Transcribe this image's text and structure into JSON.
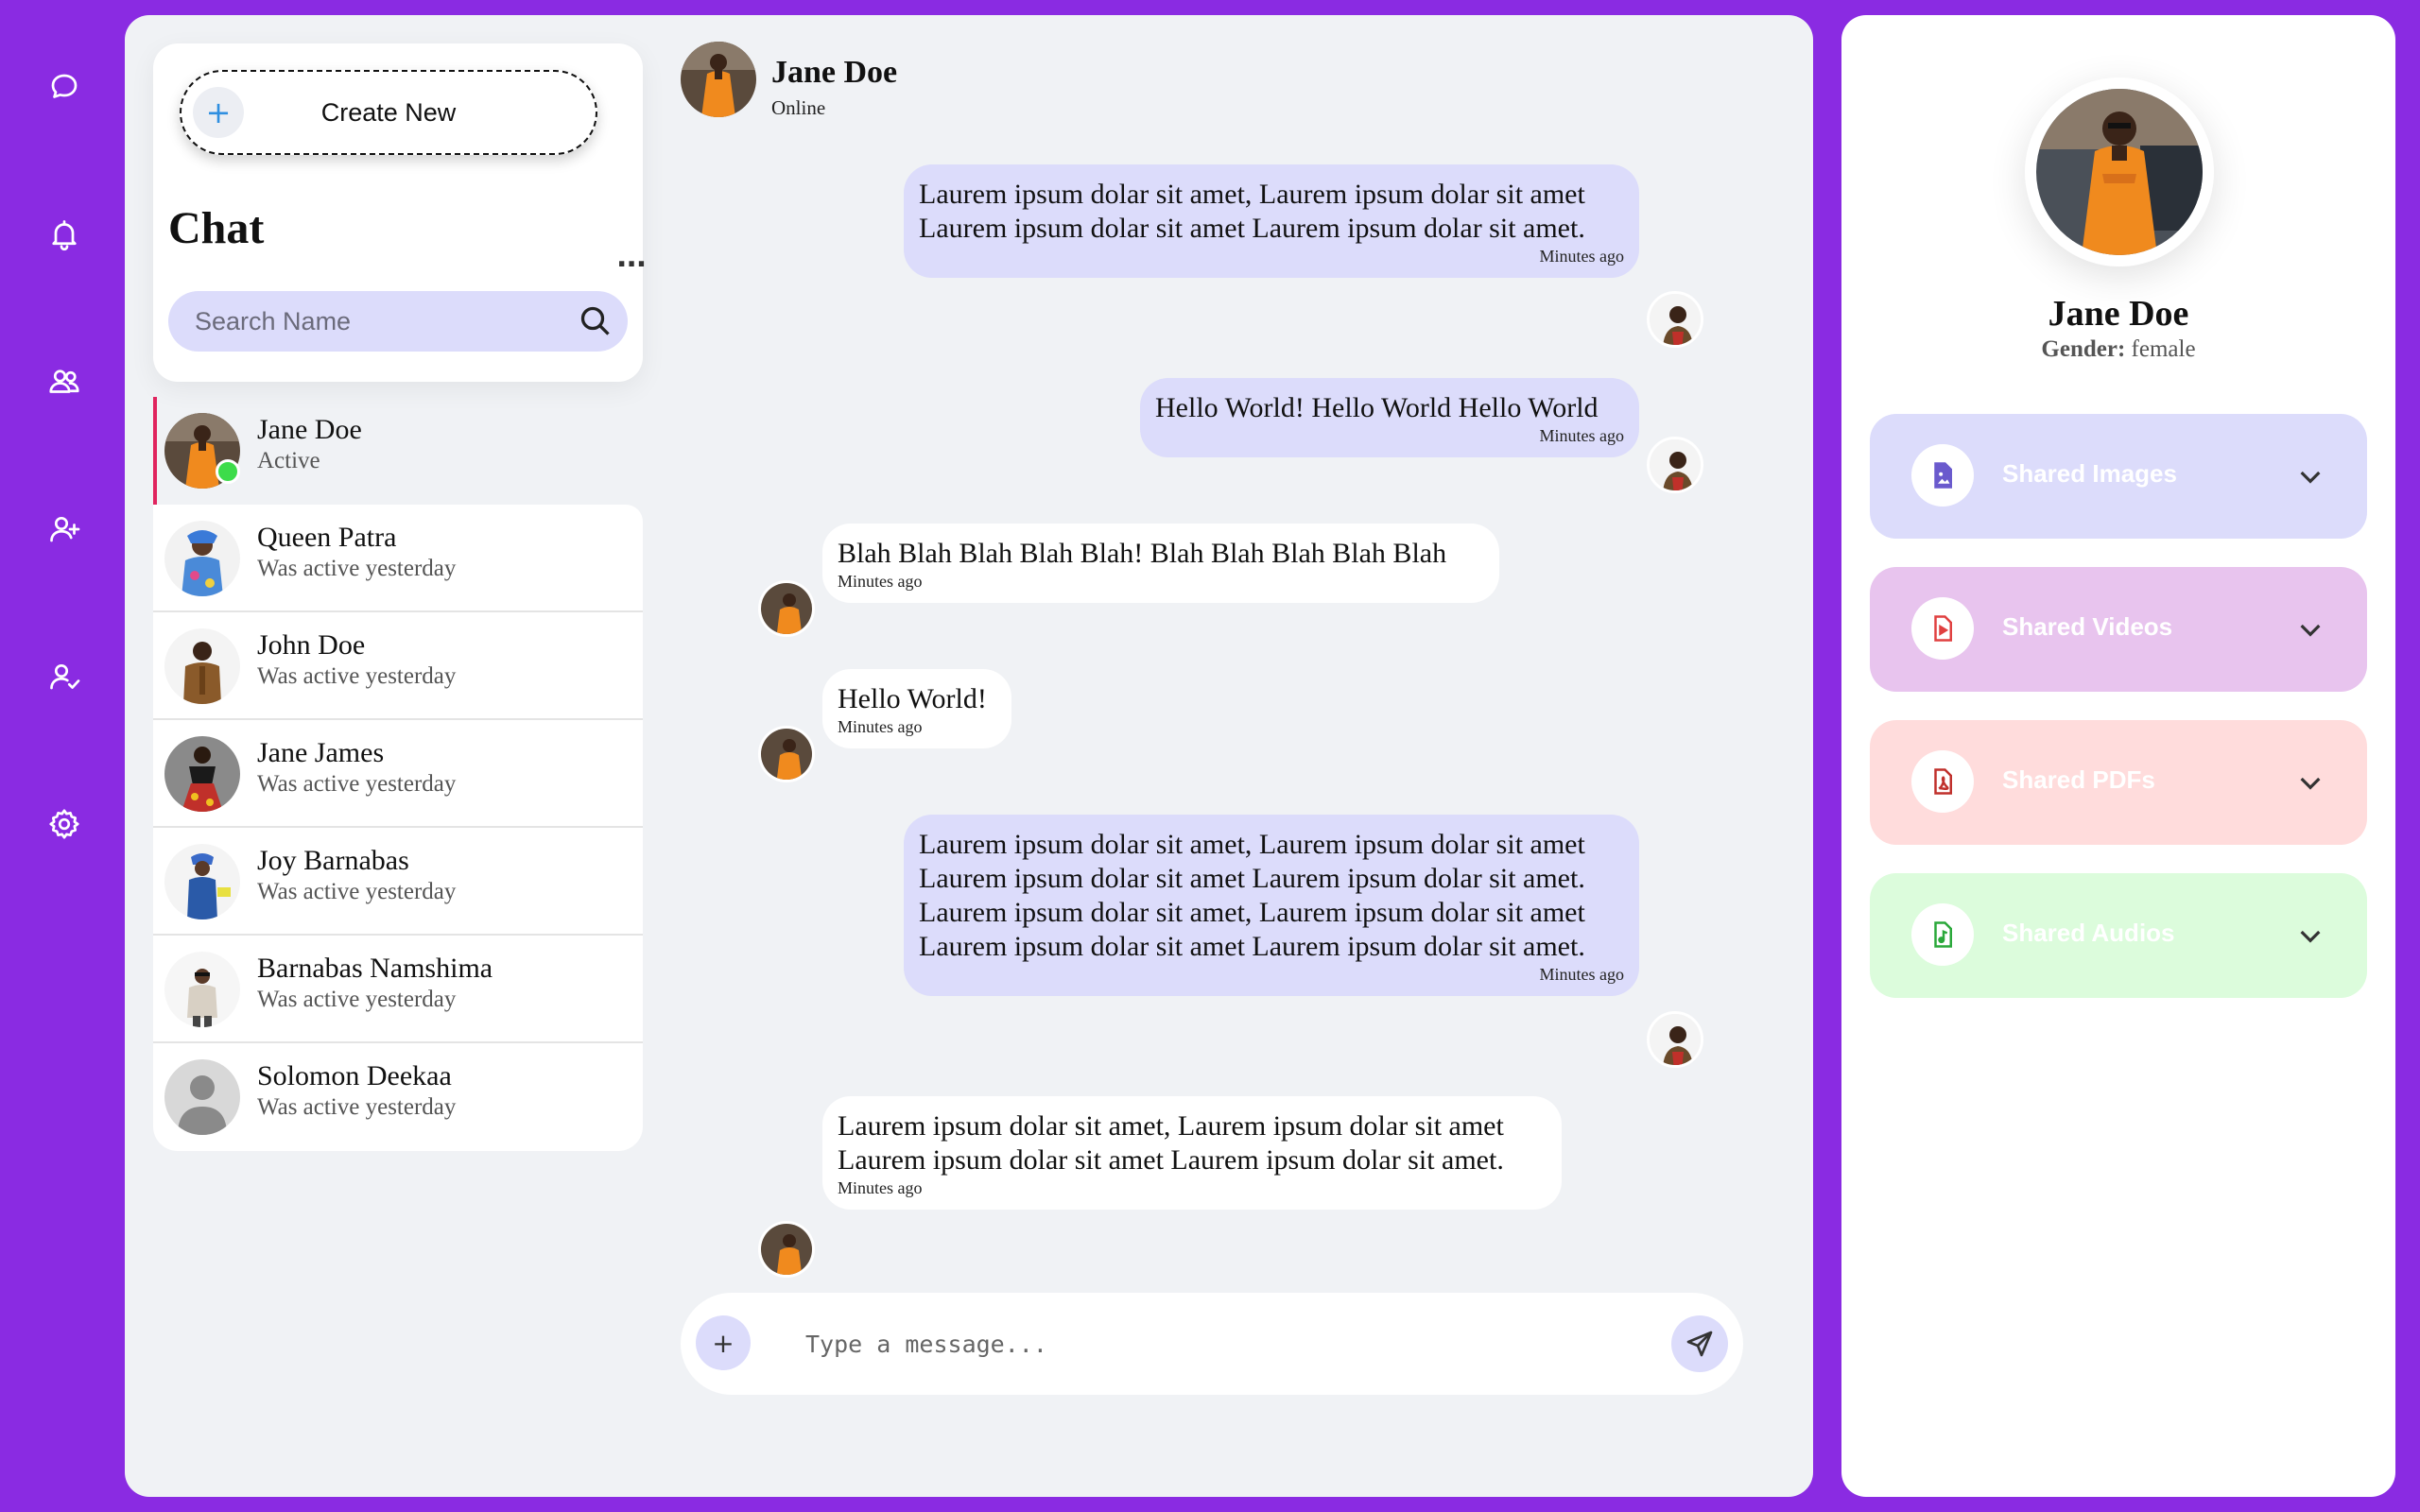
{
  "rail": {
    "icons": [
      "chat-bubble-icon",
      "bell-icon",
      "users-icon",
      "user-plus-icon",
      "user-check-icon",
      "gear-icon"
    ]
  },
  "sidebar": {
    "create_label": "Create New",
    "create_plus": "+",
    "title": "Chat",
    "more": "...",
    "search_placeholder": "Search Name",
    "active_contact": {
      "name": "Jane Doe",
      "status": "Active"
    },
    "contacts": [
      {
        "name": "Queen Patra",
        "status": "Was active yesterday"
      },
      {
        "name": "John Doe",
        "status": "Was active yesterday"
      },
      {
        "name": "Jane James",
        "status": "Was active yesterday"
      },
      {
        "name": "Joy Barnabas",
        "status": "Was active yesterday"
      },
      {
        "name": "Barnabas Namshima",
        "status": "Was active yesterday"
      },
      {
        "name": "Solomon Deekaa",
        "status": "Was active yesterday"
      }
    ]
  },
  "header": {
    "name": "Jane Doe",
    "status": "Online"
  },
  "messages": [
    {
      "from": "me",
      "text": "Laurem ipsum dolar sit amet, Laurem ipsum dolar sit amet Laurem ipsum dolar sit amet Laurem ipsum dolar sit amet.",
      "time": "Minutes ago"
    },
    {
      "from": "me",
      "text": "Hello World! Hello World Hello World",
      "time": "Minutes ago"
    },
    {
      "from": "them",
      "text": "Blah Blah Blah Blah Blah! Blah Blah Blah Blah Blah",
      "time": "Minutes ago"
    },
    {
      "from": "them",
      "text": "Hello World!",
      "time": "Minutes ago"
    },
    {
      "from": "me",
      "text": "Laurem ipsum dolar sit amet, Laurem ipsum dolar sit amet Laurem ipsum dolar sit amet Laurem ipsum dolar sit amet. Laurem ipsum dolar sit amet, Laurem ipsum dolar sit amet Laurem ipsum dolar sit amet Laurem ipsum dolar sit amet.",
      "time": "Minutes ago"
    },
    {
      "from": "them",
      "text": "Laurem ipsum dolar sit amet, Laurem ipsum dolar sit amet Laurem ipsum dolar sit amet Laurem ipsum dolar sit amet.",
      "time": "Minutes ago"
    }
  ],
  "composer": {
    "attach": "+",
    "placeholder": "Type a message..."
  },
  "profile": {
    "name": "Jane Doe",
    "gender_label": "Gender:",
    "gender_value": "female",
    "shared": [
      {
        "label": "Shared Images",
        "icon": "image-file-icon",
        "color": "#dcdcfb",
        "icon_color": "#6a5acd"
      },
      {
        "label": "Shared Videos",
        "icon": "video-file-icon",
        "color": "#e8c4ee",
        "icon_color": "#e04040"
      },
      {
        "label": "Shared PDFs",
        "icon": "pdf-file-icon",
        "color": "#ffdcdc",
        "icon_color": "#c0302c"
      },
      {
        "label": "Shared Audios",
        "icon": "audio-file-icon",
        "color": "#dcfcdc",
        "icon_color": "#2aa83a"
      }
    ]
  },
  "colors": {
    "background": "#8a2be2",
    "accent_bubble": "#dcdcfb",
    "active_bar": "#e0245e",
    "online": "#3ddc4a"
  }
}
